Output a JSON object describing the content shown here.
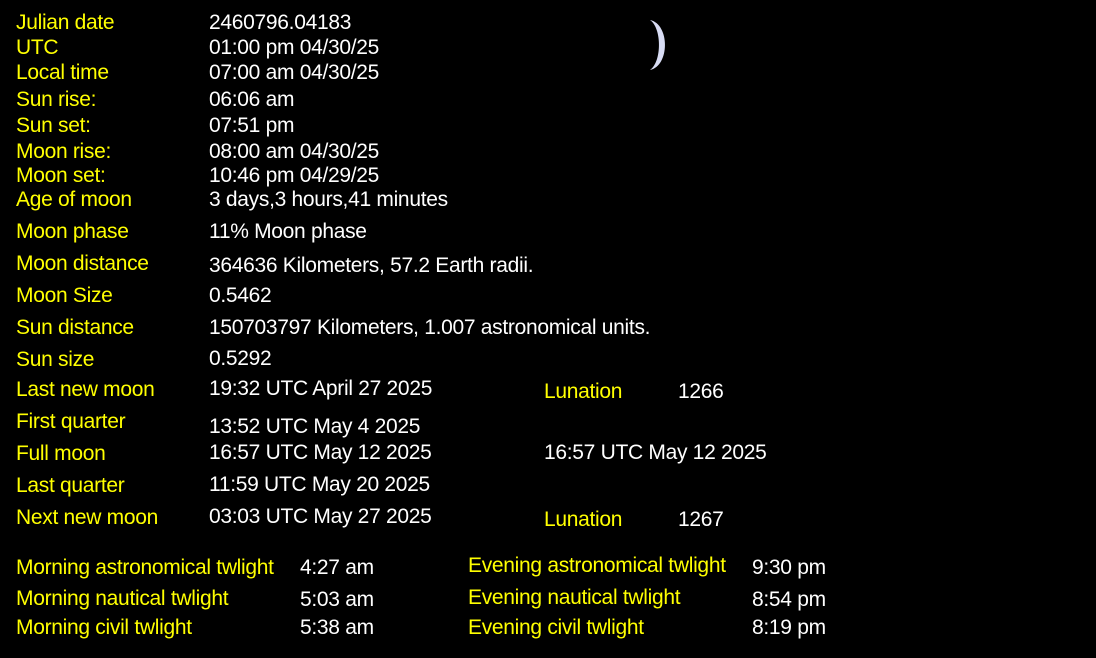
{
  "colors": {
    "background": "#000000",
    "label": "#ffff00",
    "value": "#ffffff",
    "moon": "#d8dcf4"
  },
  "icon": "crescent-moon-icon",
  "rows": {
    "julian_date": {
      "label": "Julian date",
      "value": "2460796.04183"
    },
    "utc": {
      "label": "UTC",
      "value": "01:00 pm 04/30/25"
    },
    "local_time": {
      "label": "Local time",
      "value": "07:00 am 04/30/25"
    },
    "sun_rise": {
      "label": "Sun rise:",
      "value": "06:06 am"
    },
    "sun_set": {
      "label": "Sun set:",
      "value": "07:51 pm"
    },
    "moon_rise": {
      "label": "Moon rise:",
      "value": "08:00 am 04/30/25"
    },
    "moon_set": {
      "label": "Moon set:",
      "value": "10:46 pm 04/29/25"
    },
    "age_of_moon": {
      "label": "Age of moon",
      "value": "3 days,3 hours,41 minutes"
    },
    "moon_phase": {
      "label": "Moon phase",
      "value": "11% Moon phase"
    },
    "moon_distance": {
      "label": "Moon distance",
      "value": "364636 Kilometers, 57.2 Earth radii."
    },
    "moon_size": {
      "label": "Moon Size",
      "value": "0.5462"
    },
    "sun_distance": {
      "label": "Sun distance",
      "value": "150703797 Kilometers,  1.007 astronomical units."
    },
    "sun_size": {
      "label": "Sun size",
      "value": "0.5292"
    }
  },
  "phases": {
    "last_new_moon": {
      "label": "Last new moon",
      "value": "19:32 UTC April 27 2025",
      "lunation_label": "Lunation",
      "lunation_value": "1266"
    },
    "first_quarter": {
      "label": "First quarter",
      "value": "13:52 UTC May 4 2025"
    },
    "full_moon": {
      "label": "Full moon",
      "value": "16:57 UTC May 12 2025",
      "extra": "16:57 UTC May 12 2025"
    },
    "last_quarter": {
      "label": "Last quarter",
      "value": "11:59 UTC May 20 2025"
    },
    "next_new_moon": {
      "label": "Next new moon",
      "value": "03:03 UTC May 27 2025",
      "lunation_label": "Lunation",
      "lunation_value": "1267"
    }
  },
  "twilight": {
    "morning_astronomical": {
      "label": "Morning astronomical twlight",
      "value": "4:27 am"
    },
    "morning_nautical": {
      "label": "Morning nautical twlight",
      "value": "5:03 am"
    },
    "morning_civil": {
      "label": "Morning civil twlight",
      "value": "5:38 am"
    },
    "evening_astronomical": {
      "label": "Evening astronomical twlight",
      "value": "9:30 pm"
    },
    "evening_nautical": {
      "label": "Evening nautical twlight",
      "value": "8:54 pm"
    },
    "evening_civil": {
      "label": "Evening civil twlight",
      "value": "8:19 pm"
    }
  }
}
